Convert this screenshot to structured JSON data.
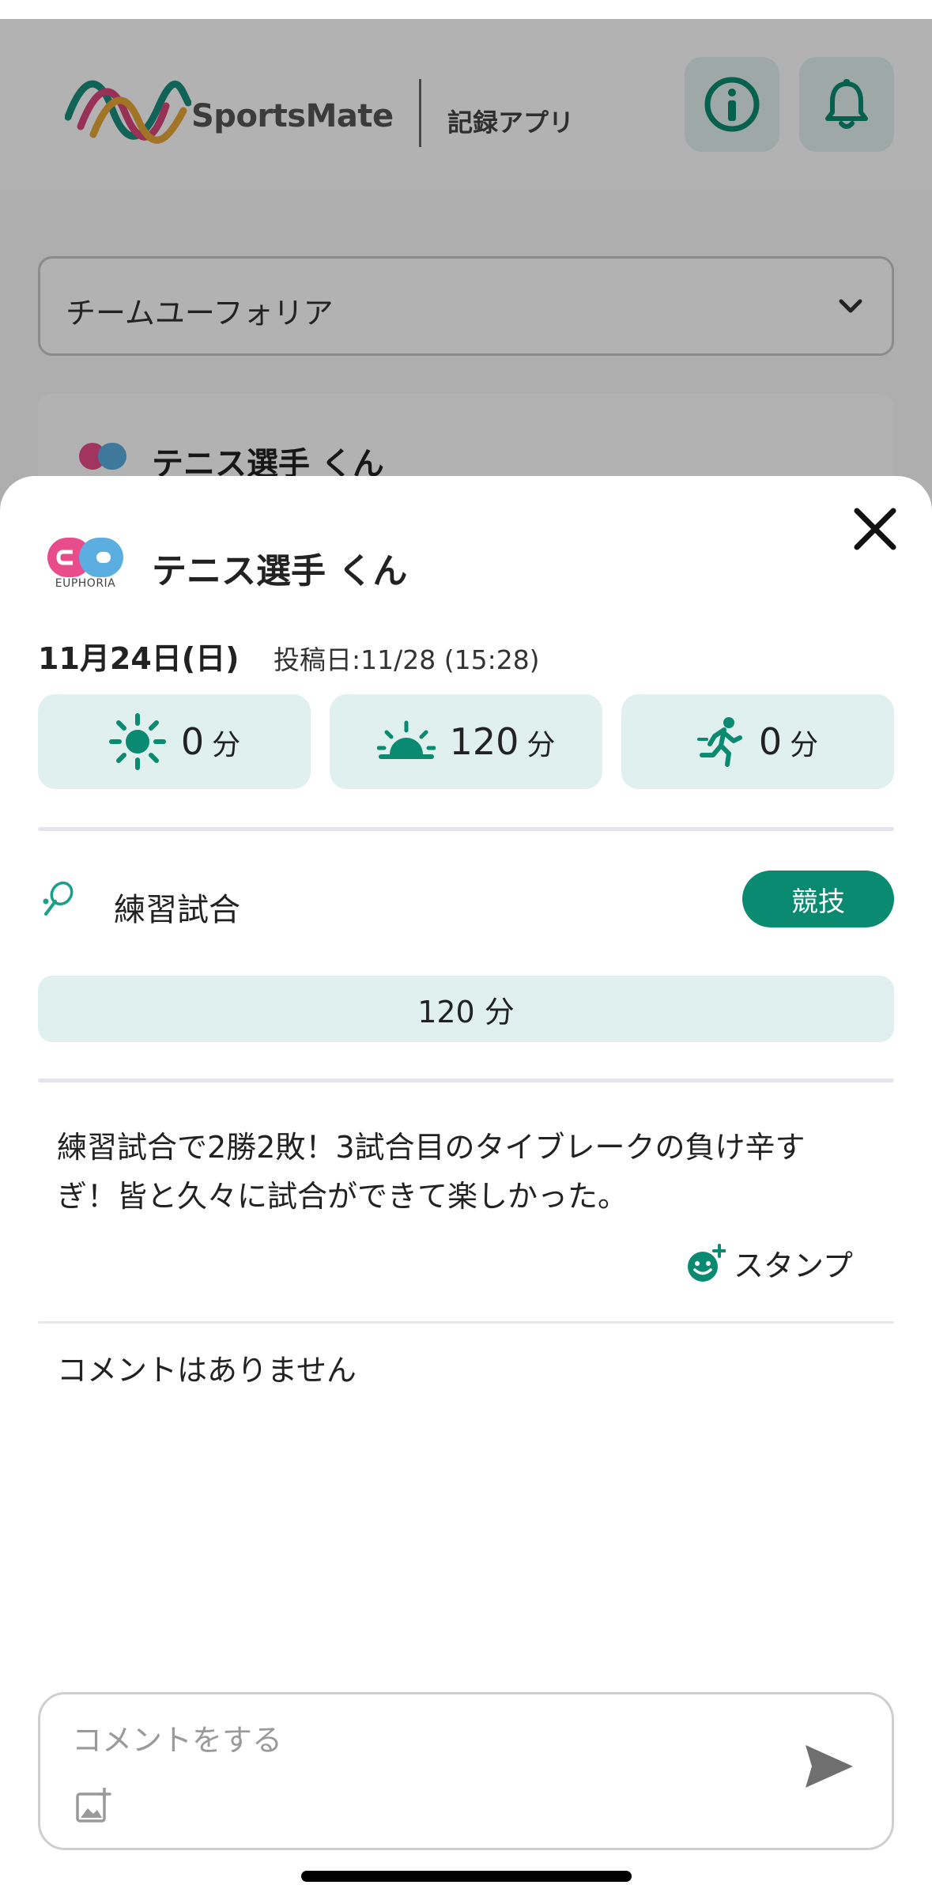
{
  "header": {
    "brand_name": "SportsMate",
    "brand_sub": "記録アプリ",
    "info_icon": "info-icon",
    "bell_icon": "bell-icon"
  },
  "team_select": {
    "value": "チームユーフォリア"
  },
  "background_card": {
    "name": "テニス選手 くん"
  },
  "sheet": {
    "avatar_caption": "EUPHORIA",
    "name": "テニス選手 くん",
    "date": "11月24日(日)",
    "posted": "投稿日:11/28 (15:28)",
    "stats": [
      {
        "icon": "sun-icon",
        "value": "0",
        "unit": "分"
      },
      {
        "icon": "sunrise-icon",
        "value": "120",
        "unit": "分"
      },
      {
        "icon": "running-icon",
        "value": "0",
        "unit": "分"
      }
    ],
    "activity": {
      "icon": "tennis-racket-icon",
      "label": "練習試合",
      "tag": "競技"
    },
    "duration": "120 分",
    "post_text": "練習試合で2勝2敗！3試合目のタイブレークの負け辛すぎ！皆と久々に試合ができて楽しかった。",
    "stamp_label": "スタンプ",
    "no_comments": "コメントはありません",
    "comment_placeholder": "コメントをする"
  },
  "colors": {
    "accent": "#0a8a70",
    "stat_bg": "#dff0ef",
    "overlay": "rgba(0,0,0,0.30)"
  }
}
